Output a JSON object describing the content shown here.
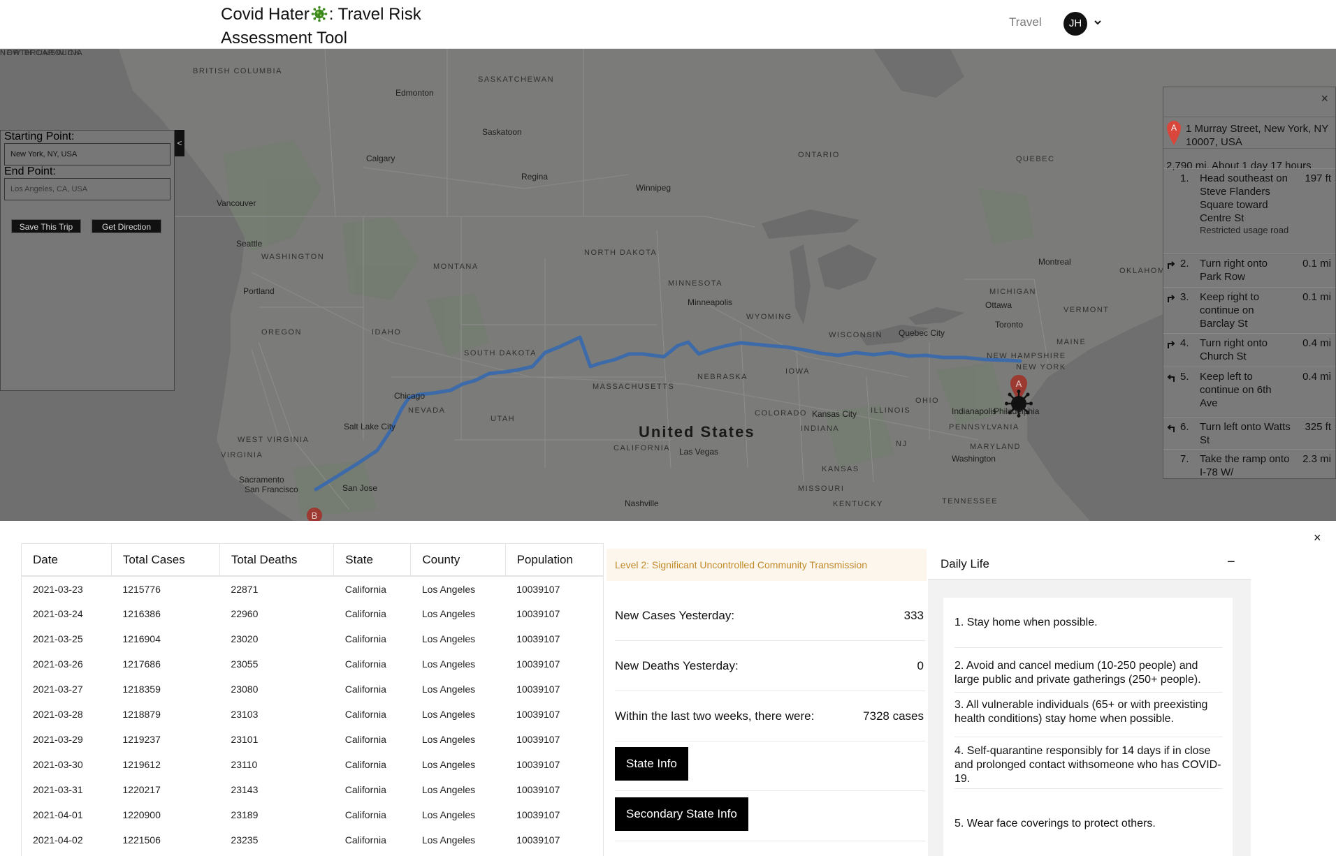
{
  "header": {
    "title_before": "Covid Hater",
    "title_after": ": Travel Risk Assessment Tool",
    "nav_travel": "Travel",
    "avatar_initials": "JH"
  },
  "map": {
    "labels": [
      {
        "text": "BRITISH COLUMBIA",
        "kind": "region"
      },
      {
        "text": "SASKATCHEWAN",
        "kind": "region"
      },
      {
        "text": "Edmonton",
        "kind": "city"
      },
      {
        "text": "Saskatoon",
        "kind": "city"
      },
      {
        "text": "Calgary",
        "kind": "city"
      },
      {
        "text": "Regina",
        "kind": "city"
      },
      {
        "text": "Winnipeg",
        "kind": "city"
      },
      {
        "text": "ONTARIO",
        "kind": "region"
      },
      {
        "text": "QUEBEC",
        "kind": "region"
      },
      {
        "text": "Vancouver",
        "kind": "city"
      },
      {
        "text": "Seattle",
        "kind": "city"
      },
      {
        "text": "WASHINGTON",
        "kind": "region"
      },
      {
        "text": "MONTANA",
        "kind": "region"
      },
      {
        "text": "NORTH DAKOTA",
        "kind": "region"
      },
      {
        "text": "MINNESOTA",
        "kind": "region"
      },
      {
        "text": "Minneapolis",
        "kind": "city"
      },
      {
        "text": "Portland",
        "kind": "city"
      },
      {
        "text": "OREGON",
        "kind": "region"
      },
      {
        "text": "IDAHO",
        "kind": "region"
      },
      {
        "text": "SOUTH DAKOTA",
        "kind": "region"
      },
      {
        "text": "WYOMING",
        "kind": "region"
      },
      {
        "text": "WISCONSIN",
        "kind": "region"
      },
      {
        "text": "MICHIGAN",
        "kind": "region"
      },
      {
        "text": "Ottawa",
        "kind": "city"
      },
      {
        "text": "Montreal",
        "kind": "city"
      },
      {
        "text": "Quebec City",
        "kind": "city"
      },
      {
        "text": "Toronto",
        "kind": "city"
      },
      {
        "text": "VERMONT",
        "kind": "region"
      },
      {
        "text": "MAINE",
        "kind": "region"
      },
      {
        "text": "NEW HAMPSHIRE",
        "kind": "region"
      },
      {
        "text": "NEW YORK",
        "kind": "region"
      },
      {
        "text": "MASSACHUSETTS",
        "kind": "region"
      },
      {
        "text": "NEBRASKA",
        "kind": "region"
      },
      {
        "text": "IOWA",
        "kind": "region"
      },
      {
        "text": "Chicago",
        "kind": "city"
      },
      {
        "text": "Salt Lake City",
        "kind": "city"
      },
      {
        "text": "NEVADA",
        "kind": "region"
      },
      {
        "text": "UTAH",
        "kind": "region"
      },
      {
        "text": "United States",
        "kind": "country"
      },
      {
        "text": "COLORADO",
        "kind": "region"
      },
      {
        "text": "Kansas City",
        "kind": "city"
      },
      {
        "text": "ILLINOIS",
        "kind": "region"
      },
      {
        "text": "INDIANA",
        "kind": "region"
      },
      {
        "text": "OHIO",
        "kind": "region"
      },
      {
        "text": "Indianapolis",
        "kind": "city"
      },
      {
        "text": "PENNSYLVANIA",
        "kind": "region"
      },
      {
        "text": "Philadelphia",
        "kind": "city"
      },
      {
        "text": "MARYLAND",
        "kind": "region"
      },
      {
        "text": "NJ",
        "kind": "region"
      },
      {
        "text": "Washington",
        "kind": "city"
      },
      {
        "text": "WEST VIRGINIA",
        "kind": "region"
      },
      {
        "text": "VIRGINIA",
        "kind": "region"
      },
      {
        "text": "Sacramento",
        "kind": "city"
      },
      {
        "text": "San Francisco",
        "kind": "city"
      },
      {
        "text": "San Jose",
        "kind": "city"
      },
      {
        "text": "CALIFORNIA",
        "kind": "region"
      },
      {
        "text": "Las Vegas",
        "kind": "city"
      },
      {
        "text": "KANSAS",
        "kind": "region"
      },
      {
        "text": "MISSOURI",
        "kind": "region"
      },
      {
        "text": "KENTUCKY",
        "kind": "region"
      },
      {
        "text": "Nashville",
        "kind": "city"
      },
      {
        "text": "TENNESSEE",
        "kind": "region"
      },
      {
        "text": "OKLAHOMA",
        "kind": "region"
      },
      {
        "text": "NORTH CAROLINA",
        "kind": "region"
      },
      {
        "text": "NEW BRUNSWICK",
        "kind": "region"
      }
    ],
    "marker_a": "A",
    "marker_b": "B"
  },
  "trip_form": {
    "start_label": "Starting Point:",
    "start_value": "New York, NY, USA",
    "end_label": "End Point:",
    "end_placeholder": "Los Angeles, CA, USA",
    "save_button": "Save This Trip",
    "direction_button": "Get Direction",
    "collapse_glyph": "<"
  },
  "directions": {
    "close_glyph": "×",
    "origin_marker": "A",
    "origin_address": "1 Murray Street, New York, NY 10007, USA",
    "summary": "2,790 mi. About 1 day 17 hours",
    "steps": [
      {
        "num": "1.",
        "text": "Head southeast on Steve Flanders Square toward Centre St",
        "note": "Restricted usage road",
        "dist": "197 ft",
        "turn": "none"
      },
      {
        "num": "2.",
        "text": "Turn right onto Park Row",
        "note": "",
        "dist": "0.1 mi",
        "turn": "right"
      },
      {
        "num": "3.",
        "text": "Keep right to continue on Barclay St",
        "note": "",
        "dist": "0.1 mi",
        "turn": "right"
      },
      {
        "num": "4.",
        "text": "Turn right onto Church St",
        "note": "",
        "dist": "0.4 mi",
        "turn": "right"
      },
      {
        "num": "5.",
        "text": "Keep left to continue on 6th Ave",
        "note": "",
        "dist": "0.4 mi",
        "turn": "left"
      },
      {
        "num": "6.",
        "text": "Turn left onto Watts St",
        "note": "",
        "dist": "325 ft",
        "turn": "left"
      },
      {
        "num": "7.",
        "text": "Take the ramp onto I-78 W/",
        "note": "",
        "dist": "2.3 mi",
        "turn": "none"
      }
    ]
  },
  "bottom": {
    "close_glyph": "×"
  },
  "table": {
    "columns": [
      "Date",
      "Total Cases",
      "Total Deaths",
      "State",
      "County",
      "Population"
    ],
    "rows": [
      [
        "2021-03-23",
        "1215776",
        "22871",
        "California",
        "Los Angeles",
        "10039107"
      ],
      [
        "2021-03-24",
        "1216386",
        "22960",
        "California",
        "Los Angeles",
        "10039107"
      ],
      [
        "2021-03-25",
        "1216904",
        "23020",
        "California",
        "Los Angeles",
        "10039107"
      ],
      [
        "2021-03-26",
        "1217686",
        "23055",
        "California",
        "Los Angeles",
        "10039107"
      ],
      [
        "2021-03-27",
        "1218359",
        "23080",
        "California",
        "Los Angeles",
        "10039107"
      ],
      [
        "2021-03-28",
        "1218879",
        "23103",
        "California",
        "Los Angeles",
        "10039107"
      ],
      [
        "2021-03-29",
        "1219237",
        "23101",
        "California",
        "Los Angeles",
        "10039107"
      ],
      [
        "2021-03-30",
        "1219612",
        "23110",
        "California",
        "Los Angeles",
        "10039107"
      ],
      [
        "2021-03-31",
        "1220217",
        "23143",
        "California",
        "Los Angeles",
        "10039107"
      ],
      [
        "2021-04-01",
        "1220900",
        "23189",
        "California",
        "Los Angeles",
        "10039107"
      ],
      [
        "2021-04-02",
        "1221506",
        "23235",
        "California",
        "Los Angeles",
        "10039107"
      ]
    ]
  },
  "risk": {
    "level_text": "Level 2: Significant Uncontrolled Community Transmission",
    "new_cases_label": "New Cases Yesterday:",
    "new_cases_value": "333",
    "new_deaths_label": "New Deaths Yesterday:",
    "new_deaths_value": "0",
    "two_weeks_label": "Within the last two weeks, there were:",
    "two_weeks_value": "7328 cases",
    "state_info_button": "State Info",
    "secondary_state_info_button": "Secondary State Info"
  },
  "daily_life": {
    "title": "Daily Life",
    "collapse_glyph": "−",
    "rules": [
      "1. Stay home when possible.",
      "2. Avoid and cancel medium (10-250 people) and large public and private gatherings (250+ people).",
      "3. All vulnerable individuals (65+ or with preexisting health conditions) stay home when possible.",
      "4. Self-quarantine responsibly for 14 days if in close and prolonged contact withsomeone who has COVID-19.",
      "5. Wear face coverings to protect others."
    ]
  },
  "colors": {
    "route": "#3d6aa8",
    "marker_red": "#d9463b",
    "risk_text": "#c08a2a",
    "risk_bg": "#fdf6ec",
    "virus_green": "#3d8a1f"
  }
}
